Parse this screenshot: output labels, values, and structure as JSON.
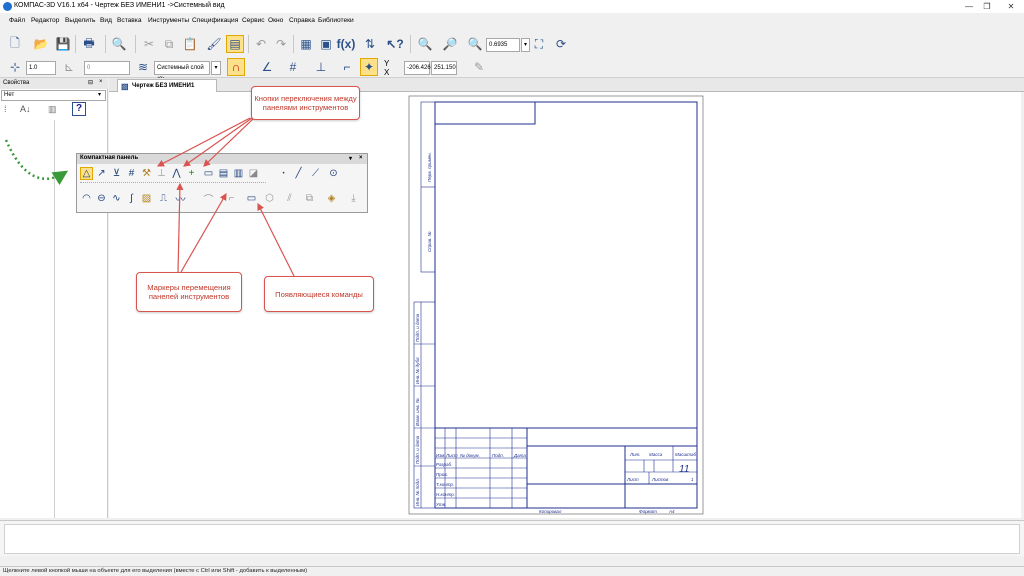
{
  "window": {
    "title": "КОМПАС-3D V16.1 x64 - Чертеж БЕЗ ИМЕНИ1 ->Системный вид",
    "minimize": "—",
    "maximize": "❐"
  },
  "menu": [
    "Файл",
    "Редактор",
    "Выделить",
    "Вид",
    "Вставка",
    "Инструменты",
    "Спецификация",
    "Сервис",
    "Окно",
    "Справка",
    "Библиотеки"
  ],
  "toolbar_top": {
    "zoom_value": "0.6935"
  },
  "toolbar_second": {
    "step_value": "1.0",
    "angle_value": "0",
    "layer_value": "Системный слой (0)",
    "coord_y_label": "Y",
    "coord_x_label": "X",
    "coord_x_value": "-206.426",
    "coord_y_value": "251.150"
  },
  "left_panel": {
    "title": "Свойства",
    "pin": "⊟",
    "close": "×",
    "combo_value": "Нет"
  },
  "doc_tab": {
    "label": "Чертеж БЕЗ ИМЕНИ1"
  },
  "compact_panel": {
    "title": "Компактная панель",
    "menu": "▾",
    "close": "×"
  },
  "callouts": {
    "switch_buttons": "Кнопки переключения между панелями инструментов",
    "move_markers": "Маркеры перемещения панелей инструментов",
    "appearing_commands": "Появляющиеся команды"
  },
  "title_block": {
    "sheet_number": "11",
    "copied": "Копировал",
    "format": "Формат",
    "format_value": "А4",
    "lit": "Лит.",
    "mass": "Масса",
    "scale": "Масштаб",
    "sheet": "Лист",
    "sheets": "Листов",
    "sheets_count": "1",
    "izm": "Изм.",
    "list_col": "Лист",
    "doc_no": "№ докум.",
    "sign": "Подп.",
    "date": "Дата",
    "razrab": "Разраб.",
    "prov": "Пров.",
    "tkontr": "Т.контр.",
    "nkontr": "Н.контр.",
    "utv": "Утв."
  },
  "side_stamp": {
    "perv_primen": "Перв. примен.",
    "sprav_no": "Справ. №",
    "podp_data_1": "Подп. и дата",
    "inv_dubl": "Инв. № дубл.",
    "vzam_inv": "Взам. инв. №",
    "podp_data_2": "Подп. и дата",
    "inv_podl": "Инв. № подл."
  },
  "status": "Щелкните левой кнопкой мыши на объекте для его выделения (вместе с Ctrl или Shift - добавить к выделенным)",
  "colors": {
    "frame": "#1f2f8f",
    "callout_border": "#d9534f",
    "callout_text": "#c0392b",
    "arrow": "#d9534f",
    "green_marker": "#3a9a3a"
  }
}
